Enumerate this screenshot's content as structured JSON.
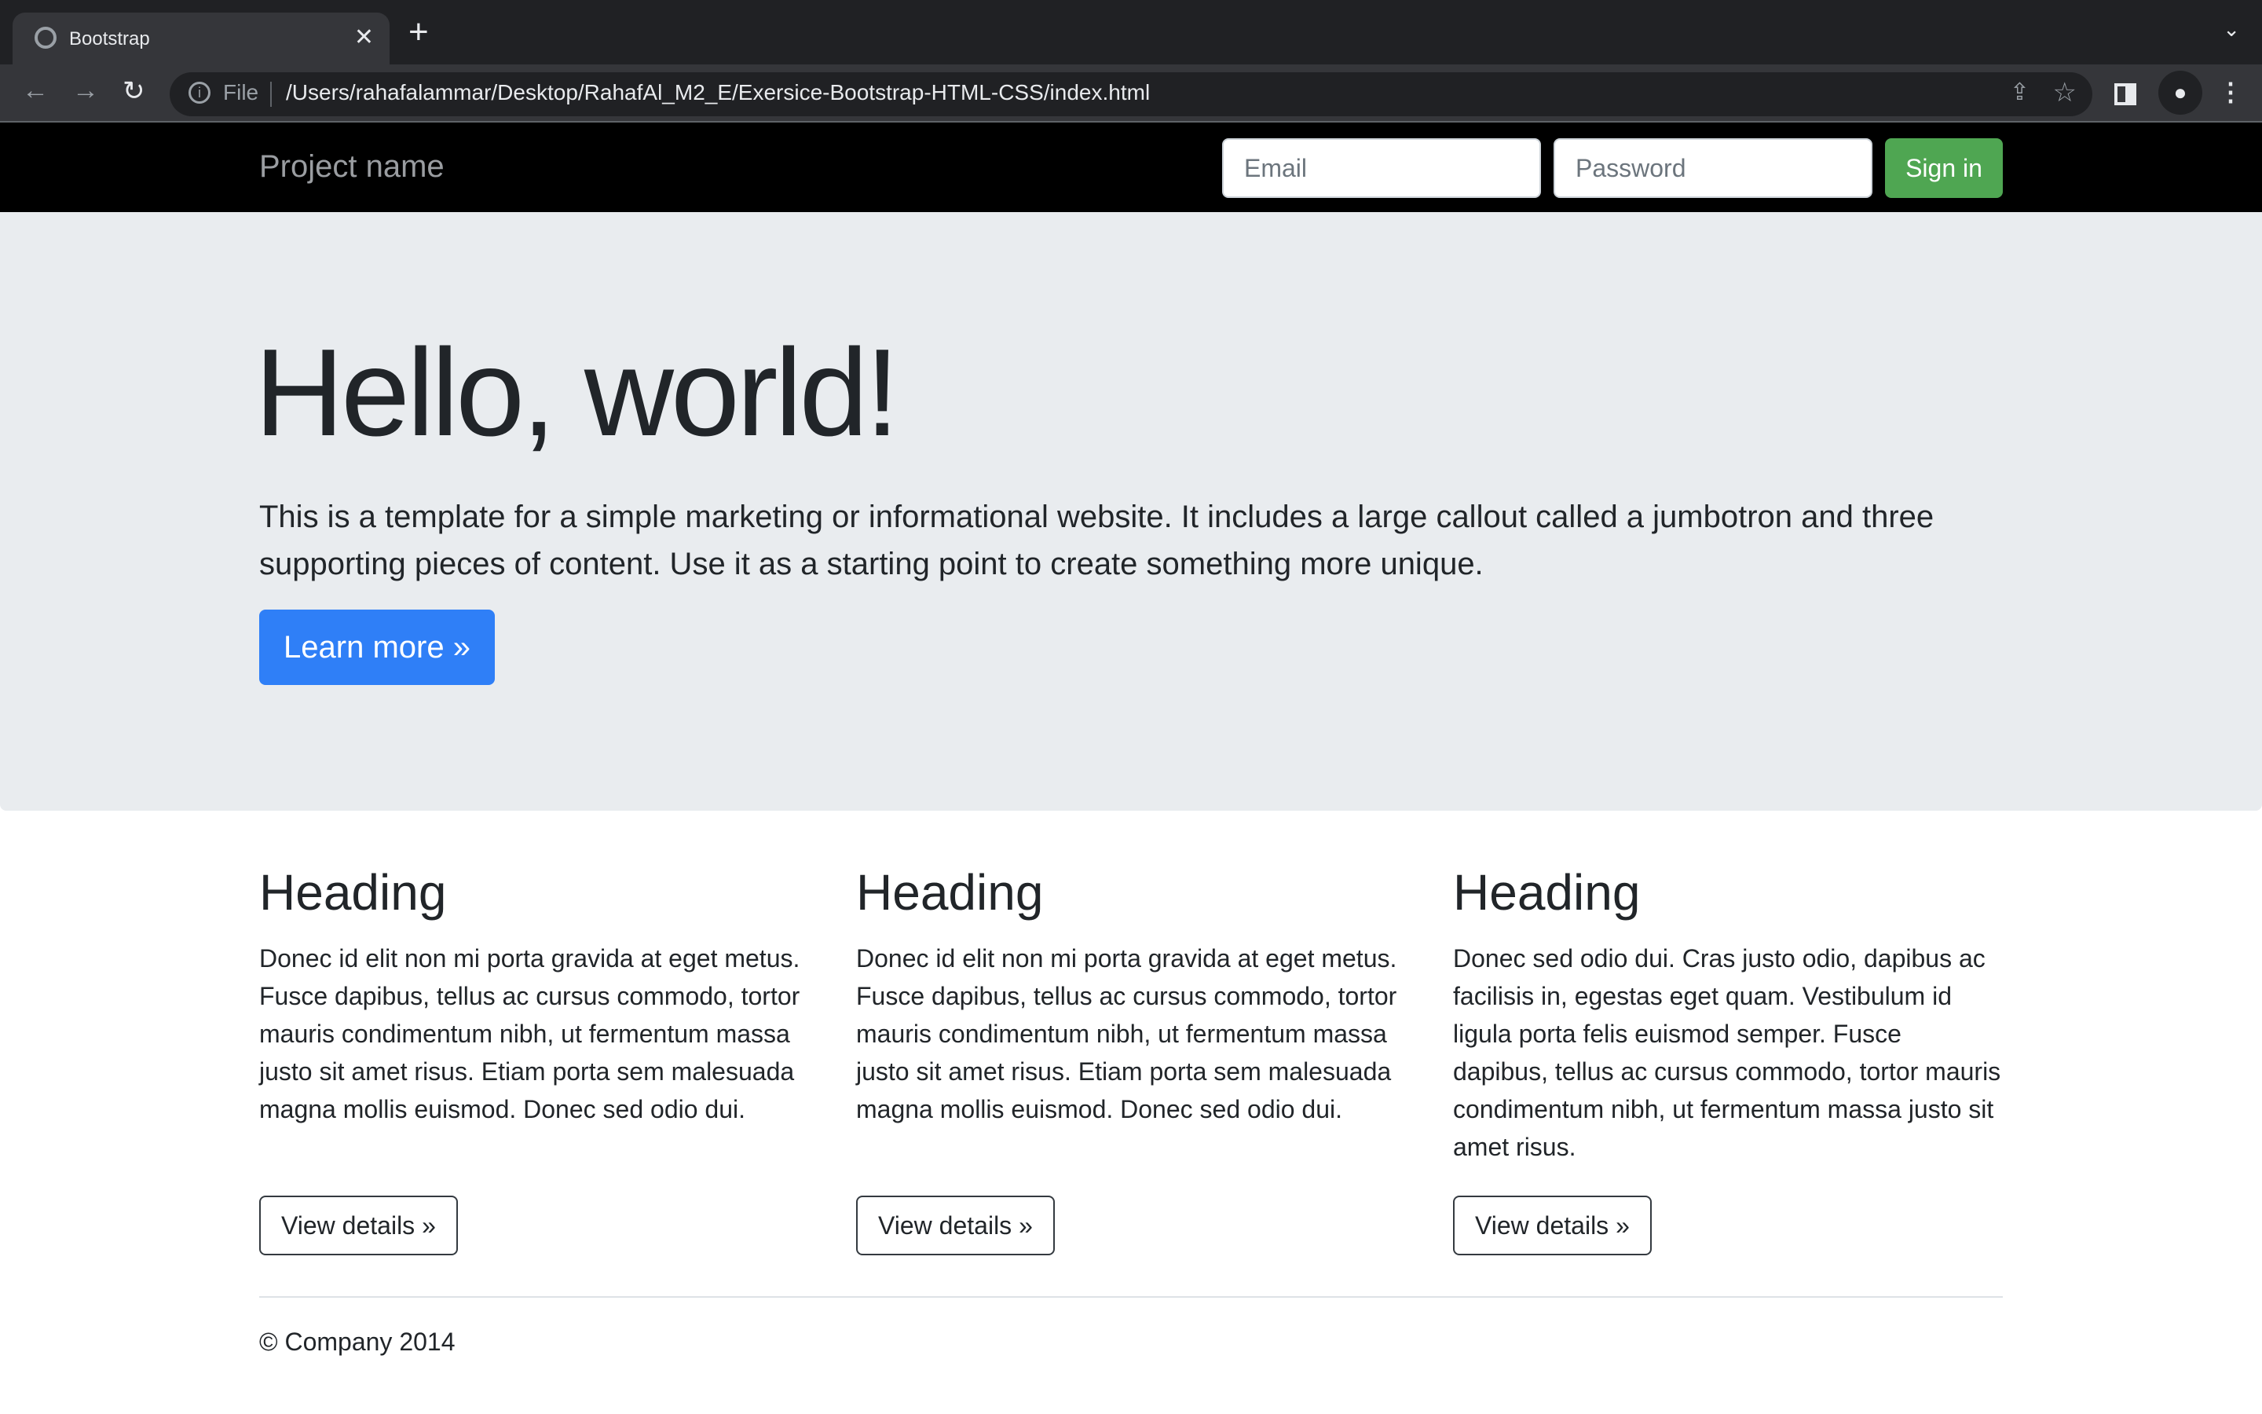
{
  "browser": {
    "tab_title": "Bootstrap",
    "url_scheme": "File",
    "url": "/Users/rahafalammar/Desktop/RahafAl_M2_E/Exersice-Bootstrap-HTML-CSS/index.html"
  },
  "navbar": {
    "brand": "Project name",
    "email_placeholder": "Email",
    "password_placeholder": "Password",
    "signin_label": "Sign in"
  },
  "jumbotron": {
    "title": "Hello, world!",
    "lead": "This is a template for a simple marketing or informational website. It includes a large callout called a jumbotron and three supporting pieces of content. Use it as a starting point to create something more unique.",
    "button": "Learn more »"
  },
  "columns": [
    {
      "heading": "Heading",
      "text": "Donec id elit non mi porta gravida at eget metus. Fusce dapibus, tellus ac cursus commodo, tortor mauris condimentum nibh, ut fermentum massa justo sit amet risus. Etiam porta sem malesuada magna mollis euismod. Donec sed odio dui.",
      "button": "View details »"
    },
    {
      "heading": "Heading",
      "text": "Donec id elit non mi porta gravida at eget metus. Fusce dapibus, tellus ac cursus commodo, tortor mauris condimentum nibh, ut fermentum massa justo sit amet risus. Etiam porta sem malesuada magna mollis euismod. Donec sed odio dui.",
      "button": "View details »"
    },
    {
      "heading": "Heading",
      "text": "Donec sed odio dui. Cras justo odio, dapibus ac facilisis in, egestas eget quam. Vestibulum id ligula porta felis euismod semper. Fusce dapibus, tellus ac cursus commodo, tortor mauris condimentum nibh, ut fermentum massa justo sit amet risus.",
      "button": "View details »"
    }
  ],
  "footer": {
    "text": "© Company 2014"
  },
  "colors": {
    "primary": "#2f7ff7",
    "success": "#4fa652",
    "jumbotron_bg": "#e9ecef"
  }
}
